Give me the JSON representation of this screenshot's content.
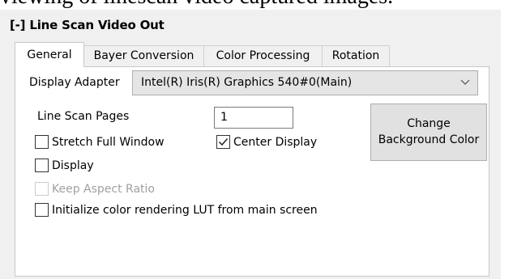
{
  "caption_fragment": "viewing of linescan video captured images.",
  "panel": {
    "title": "[-] Line Scan Video Out"
  },
  "tabs": [
    {
      "label": "General",
      "active": true
    },
    {
      "label": "Bayer Conversion",
      "active": false
    },
    {
      "label": "Color Processing",
      "active": false
    },
    {
      "label": "Rotation",
      "active": false
    }
  ],
  "general": {
    "display_adapter": {
      "label": "Display Adapter",
      "value": "Intel(R) Iris(R) Graphics 540#0(Main)",
      "icon": "chevron-down-icon"
    },
    "line_scan_pages": {
      "label": "Line Scan Pages",
      "value": "1"
    },
    "checkboxes": {
      "stretch_full_window": {
        "label": "Stretch Full Window",
        "checked": false,
        "enabled": true
      },
      "center_display": {
        "label": "Center Display",
        "checked": true,
        "enabled": true
      },
      "display": {
        "label": "Display",
        "checked": false,
        "enabled": true
      },
      "keep_aspect_ratio": {
        "label": "Keep Aspect Ratio",
        "checked": false,
        "enabled": false
      },
      "init_lut": {
        "label": "Initialize color rendering LUT from main screen",
        "checked": false,
        "enabled": true
      }
    },
    "change_bg_button": {
      "line1": "Change",
      "line2": "Background Color"
    }
  },
  "colors": {
    "panel_bg": "#f0f0f0",
    "page_bg": "#ffffff",
    "combo_bg": "#e5e5e5",
    "button_bg": "#e1e1e1",
    "disabled_text": "#a0a0a0"
  }
}
